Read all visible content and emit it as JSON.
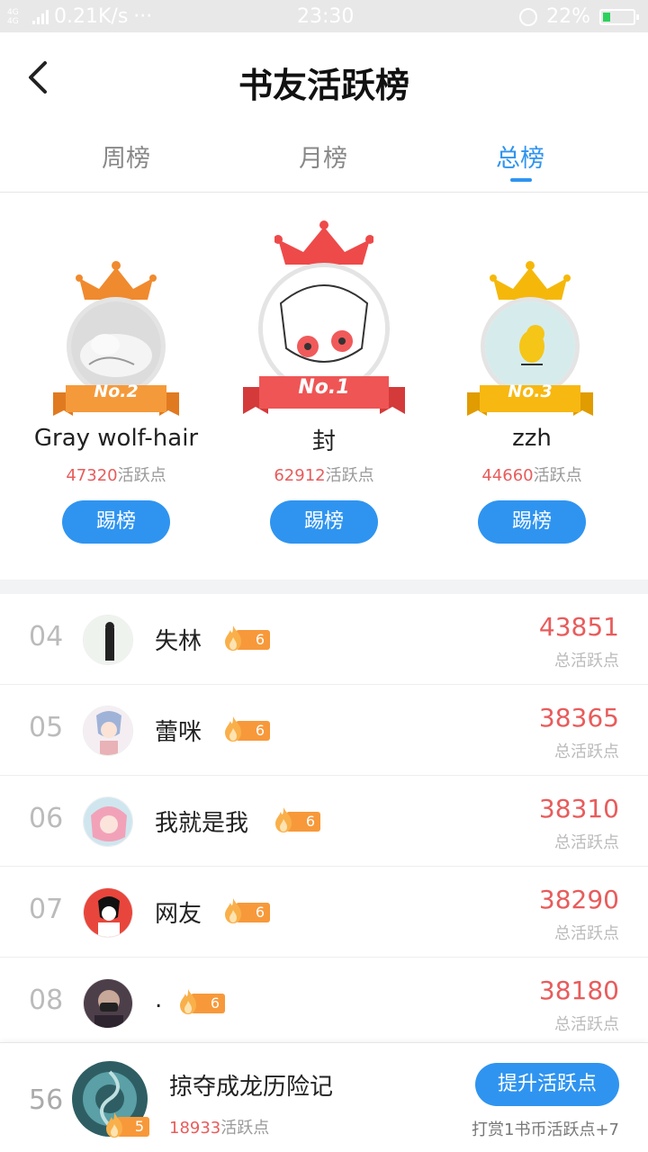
{
  "status_bar": {
    "network": "4G 4G",
    "speed": "0.21K/s",
    "dots": "···",
    "time": "23:30",
    "battery": "22%"
  },
  "header": {
    "title": "书友活跃榜",
    "back_icon": "chevron-left-icon"
  },
  "tabs": [
    {
      "label": "周榜",
      "active": false
    },
    {
      "label": "月榜",
      "active": false
    },
    {
      "label": "总榜",
      "active": true
    }
  ],
  "podium": [
    {
      "rank_label": "No.2",
      "name": "Gray wolf-hair",
      "points": "47320",
      "points_suffix": "活跃点",
      "button": "踢榜",
      "crown_color": "#f08a2e"
    },
    {
      "rank_label": "No.1",
      "name": "封",
      "points": "62912",
      "points_suffix": "活跃点",
      "button": "踢榜",
      "crown_color": "#ee4a4a"
    },
    {
      "rank_label": "No.3",
      "name": "zzh",
      "points": "44660",
      "points_suffix": "活跃点",
      "button": "踢榜",
      "crown_color": "#f5b80a"
    }
  ],
  "list": [
    {
      "rank": "04",
      "name": "失林",
      "level": "6",
      "score": "43851",
      "score_label": "总活跃点"
    },
    {
      "rank": "05",
      "name": "蕾咪",
      "level": "6",
      "score": "38365",
      "score_label": "总活跃点"
    },
    {
      "rank": "06",
      "name": "我就是我",
      "level": "6",
      "score": "38310",
      "score_label": "总活跃点"
    },
    {
      "rank": "07",
      "name": "网友",
      "level": "6",
      "score": "38290",
      "score_label": "总活跃点"
    },
    {
      "rank": "08",
      "name": ".",
      "level": "6",
      "score": "38180",
      "score_label": "总活跃点"
    }
  ],
  "me": {
    "rank": "56",
    "name": "掠夺成龙历险记",
    "level": "5",
    "points": "18933",
    "points_suffix": "活跃点",
    "button": "提升活跃点",
    "hint": "打赏1书币活跃点+7"
  },
  "colors": {
    "accent": "#2f94f0",
    "score_red": "#e85c5c",
    "level_orange": "#f7993a"
  }
}
